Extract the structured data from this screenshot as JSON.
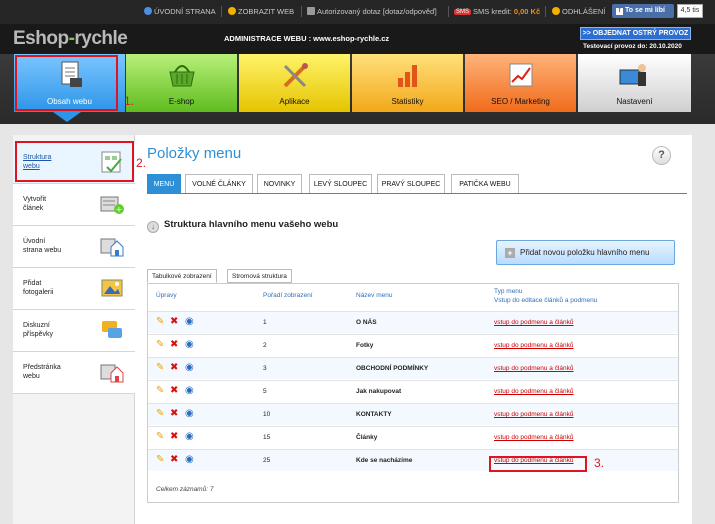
{
  "topbar": {
    "home": "ÚVODNÍ STRANA",
    "show_web": "ZOBRAZIT WEB",
    "auth_query": "Autorizovaný dotaz [dotaz/odpověď]",
    "sms_badge": "SMS",
    "sms_label": "SMS kredit:",
    "sms_value": "0,00 Kč",
    "logout": "ODHLÁŠENÍ",
    "like": "To se mi líbí",
    "like_count": "4,5 tis"
  },
  "header": {
    "logo_a": "Eshop",
    "logo_dash": "-",
    "logo_b": "rychle",
    "admin_title": "ADMINISTRACE WEBU : www.eshop-rychle.cz",
    "order_button": ">> OBJEDNAT OSTRÝ PROVOZ",
    "test_info": "Testovací provoz do: 20.10.2020"
  },
  "nav": [
    {
      "label": "Obsah webu",
      "icon": "document-icon"
    },
    {
      "label": "E-shop",
      "icon": "basket-icon"
    },
    {
      "label": "Aplikace",
      "icon": "tools-icon"
    },
    {
      "label": "Statistiky",
      "icon": "bar-chart-icon"
    },
    {
      "label": "SEO / Marketing",
      "icon": "growth-chart-icon"
    },
    {
      "label": "Nastavení",
      "icon": "user-computer-icon"
    }
  ],
  "annotations": {
    "a1": "1.",
    "a2": "2.",
    "a3": "3."
  },
  "sidebar": {
    "items": [
      {
        "label": "Struktura\nwebu",
        "icon": "structure-icon"
      },
      {
        "label": "Vytvořit\nčlánek",
        "icon": "add-article-icon"
      },
      {
        "label": "Úvodní\nstrana webu",
        "icon": "home-page-icon"
      },
      {
        "label": "Přidat\nfotogalerii",
        "icon": "gallery-icon"
      },
      {
        "label": "Diskuzní\npříspěvky",
        "icon": "discussion-icon"
      },
      {
        "label": "Předstránka\nwebu",
        "icon": "prepage-icon"
      }
    ]
  },
  "content": {
    "title": "Položky menu",
    "help": "?",
    "tabs": [
      "MENU",
      "VOLNÉ ČLÁNKY",
      "NOVINKY",
      "LEVÝ SLOUPEC",
      "PRAVÝ SLOUPEC",
      "PATIČKA WEBU"
    ],
    "section_title": "Struktura hlavního menu vašeho webu",
    "add_button": "Přidat novou položku hlavního menu",
    "subtabs": [
      "Tabulkové zobrazení",
      "Stromová struktura"
    ]
  },
  "table": {
    "headers": {
      "actions": "Úpravy",
      "order": "Pořadí zobrazení",
      "name": "Název menu",
      "type": "Typ menu",
      "type_sub": "Vstup do editace článků a podmenu"
    },
    "rows": [
      {
        "order": "1",
        "name": "O NÁS",
        "link": "vstup do podmenu a článků"
      },
      {
        "order": "2",
        "name": "Fotky",
        "link": "vstup do podmenu a článků"
      },
      {
        "order": "3",
        "name": "OBCHODNÍ PODMÍNKY",
        "link": "vstup do podmenu a článků"
      },
      {
        "order": "5",
        "name": "Jak nakupovat",
        "link": "vstup do podmenu a článků"
      },
      {
        "order": "10",
        "name": "KONTAKTY",
        "link": "vstup do podmenu a článků"
      },
      {
        "order": "15",
        "name": "Články",
        "link": "vstup do podmenu a článků"
      },
      {
        "order": "25",
        "name": "Kde se nacházíme",
        "link": "vstup do podmenu a článků"
      }
    ],
    "total": "Celkem záznamů: 7"
  }
}
